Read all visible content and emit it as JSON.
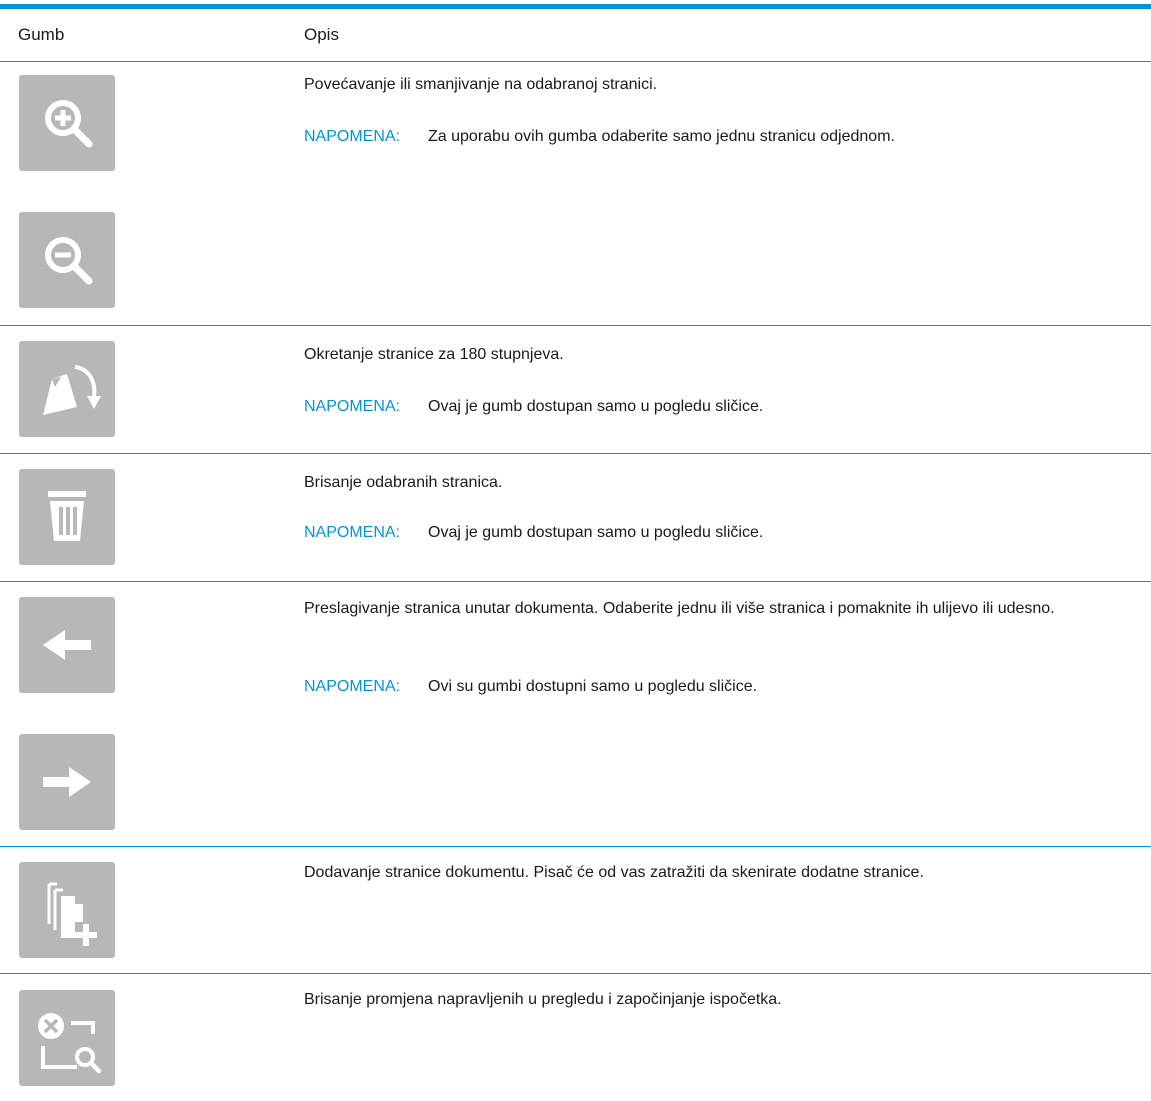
{
  "header": {
    "col_button": "Gumb",
    "col_description": "Opis"
  },
  "rows": [
    {
      "description": "Povećavanje ili smanjivanje na odabranoj stranici.",
      "note_label": "NAPOMENA:",
      "note_text": "Za uporabu ovih gumba odaberite samo jednu stranicu odjednom.",
      "icons": [
        "zoom-in-icon",
        "zoom-out-icon"
      ]
    },
    {
      "description": "Okretanje stranice za 180 stupnjeva.",
      "note_label": "NAPOMENA:",
      "note_text": "Ovaj je gumb dostupan samo u pogledu sličice.",
      "icons": [
        "rotate-page-icon"
      ]
    },
    {
      "description": "Brisanje odabranih stranica.",
      "note_label": "NAPOMENA:",
      "note_text": "Ovaj je gumb dostupan samo u pogledu sličice.",
      "icons": [
        "trash-icon"
      ]
    },
    {
      "description": "Preslagivanje stranica unutar dokumenta. Odaberite jednu ili više stranica i pomaknite ih ulijevo ili udesno.",
      "note_label": "NAPOMENA:",
      "note_text": "Ovi su gumbi dostupni samo u pogledu sličice.",
      "icons": [
        "arrow-left-icon",
        "arrow-right-icon"
      ]
    },
    {
      "description": "Dodavanje stranice dokumentu. Pisač će od vas zatražiti da skenirate dodatne stranice.",
      "icons": [
        "add-page-icon"
      ]
    },
    {
      "description": "Brisanje promjena napravljenih u pregledu i započinjanje ispočetka.",
      "icons": [
        "reset-preview-icon"
      ]
    }
  ],
  "colors": {
    "accent": "#0096d6",
    "button_bg": "#b7b7b7",
    "icon": "#ffffff"
  }
}
